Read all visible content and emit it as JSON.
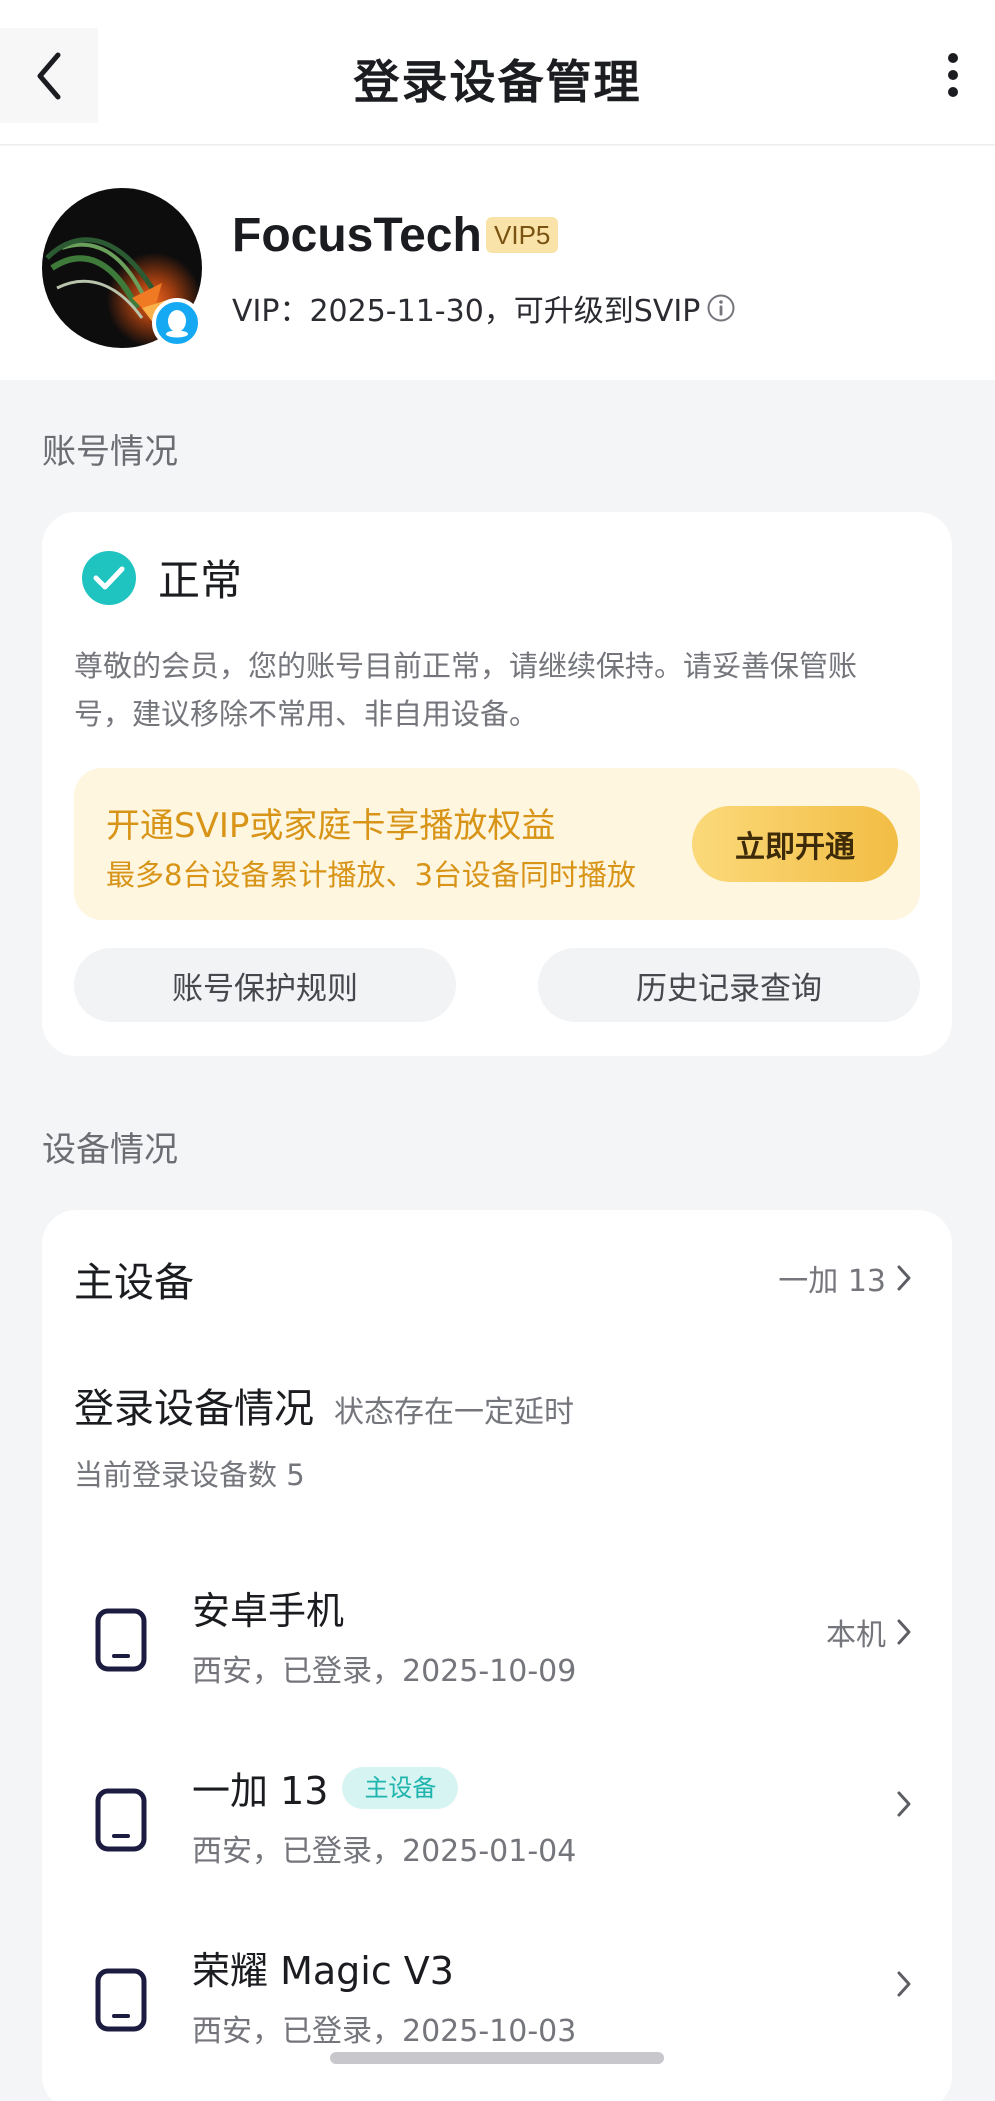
{
  "nav": {
    "title": "登录设备管理",
    "back_icon": "chevron-left-icon",
    "more_icon": "more-vertical-icon"
  },
  "profile": {
    "username": "FocusTech",
    "vip_badge": "VIP5",
    "vip_line": "VIP：2025-11-30，可升级到SVIP",
    "badge_icon": "qq-penguin-icon"
  },
  "account": {
    "section_title": "账号情况",
    "status": "正常",
    "description": "尊敬的会员，您的账号目前正常，请继续保持。请妥善保管账号，建议移除不常用、非自用设备。",
    "promo_title": "开通SVIP或家庭卡享播放权益",
    "promo_sub": "最多8台设备累计播放、3台设备同时播放",
    "promo_button": "立即开通",
    "protect_rules": "账号保护规则",
    "history": "历史记录查询"
  },
  "devices": {
    "section_title": "设备情况",
    "main_device_label": "主设备",
    "main_device_value": "一加 13",
    "login_title": "登录设备情况",
    "login_note": "状态存在一定延时",
    "login_count": "当前登录设备数 5",
    "items": [
      {
        "name": "安卓手机",
        "meta": "西安，已登录，2025-10-09",
        "right": "本机",
        "tag": ""
      },
      {
        "name": "一加 13",
        "meta": "西安，已登录，2025-01-04",
        "right": "",
        "tag": "主设备"
      },
      {
        "name": "荣耀 Magic V3",
        "meta": "西安，已登录，2025-10-03",
        "right": "",
        "tag": ""
      }
    ]
  },
  "colors": {
    "accent_teal": "#1fc4c0",
    "promo_gold": "#d89417",
    "vip_badge_bg": "#fae3a9"
  }
}
